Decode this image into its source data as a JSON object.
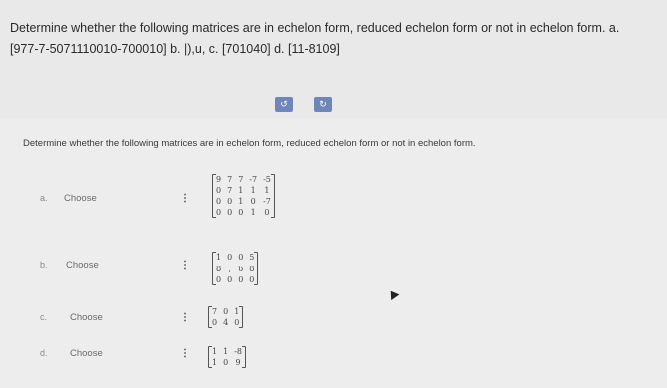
{
  "question": "Determine whether the following matrices are in echelon form, reduced echelon form or not in echelon form. a. [977-7-5071110010-700010] b. |),u, c. [701040] d. [11-8109]",
  "tabs": [
    "↺",
    "↻"
  ],
  "instruction": "Determine whether the following matrices are in echelon form, reduced echelon form or not in echelon form.",
  "rows": [
    {
      "letter": "a.",
      "choose": "Choose",
      "matrix": [
        [
          "9",
          "7",
          "7",
          "-7",
          "-5"
        ],
        [
          "0",
          "7",
          "1",
          "1",
          "1"
        ],
        [
          "0",
          "0",
          "1",
          "0",
          "-7"
        ],
        [
          "0",
          "0",
          "0",
          "1",
          "0"
        ]
      ]
    },
    {
      "letter": "b.",
      "choose": "Choose",
      "matrix": [
        [
          "1",
          "0",
          "0",
          "5"
        ],
        [
          "ʊ",
          "ˌ",
          "ʋ",
          "ʊ"
        ],
        [
          "0",
          "0",
          "0",
          "0"
        ]
      ]
    },
    {
      "letter": "c.",
      "choose": "Choose",
      "matrix": [
        [
          "7",
          "0",
          "1"
        ],
        [
          "0",
          "4",
          "0"
        ]
      ]
    },
    {
      "letter": "d.",
      "choose": "Choose",
      "matrix": [
        [
          "1",
          "1",
          "-8"
        ],
        [
          "1",
          "0",
          "9"
        ]
      ]
    }
  ],
  "colors": {
    "background": "#e9e9ea",
    "tab": "#6f86b8"
  }
}
